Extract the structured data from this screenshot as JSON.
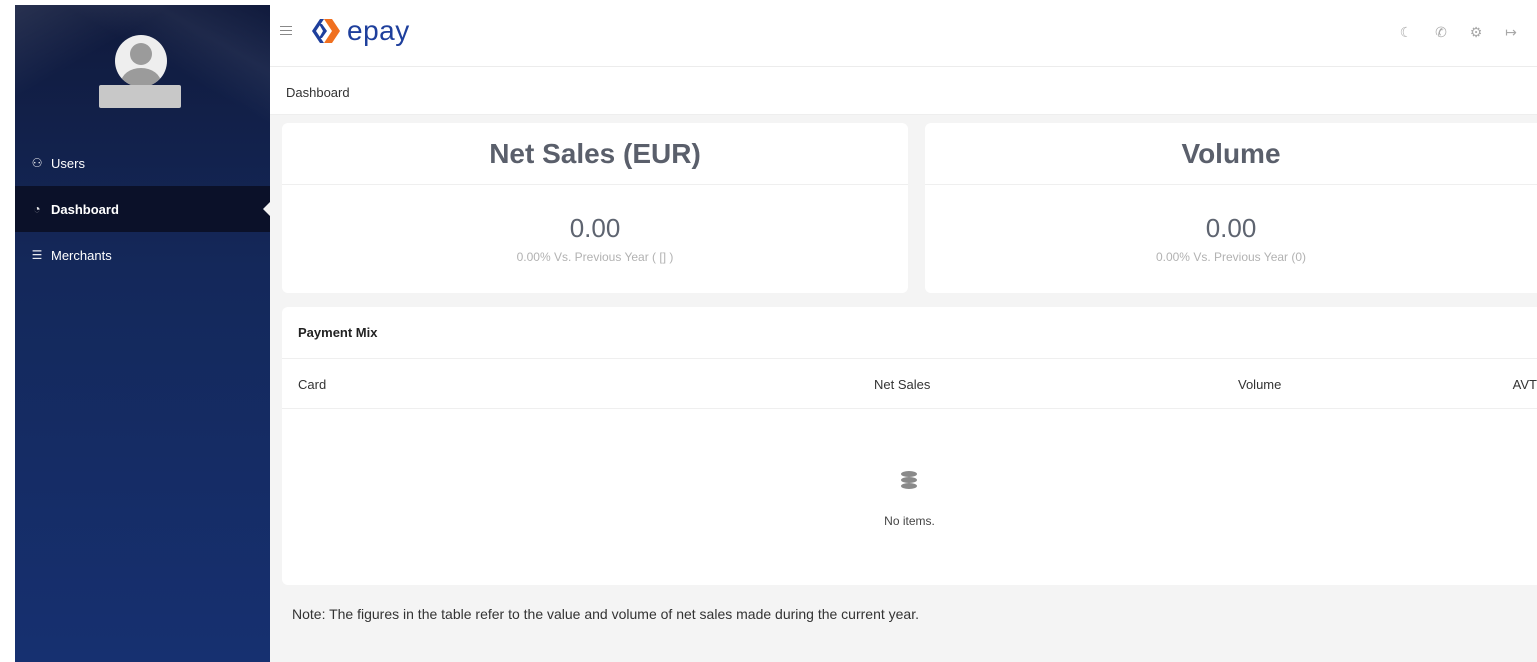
{
  "app": {
    "brand": "epay",
    "brand_color": "#1e3f9c",
    "accent_color": "#f07020",
    "sidebar_color": "#14285a"
  },
  "sidebar": {
    "items": [
      {
        "label": "Users",
        "icon": "users-icon",
        "active": false
      },
      {
        "label": "Dashboard",
        "icon": "dashboard-icon",
        "active": true
      },
      {
        "label": "Merchants",
        "icon": "merchants-icon",
        "active": false
      }
    ]
  },
  "header": {
    "icons": [
      "moon-icon",
      "phone-icon",
      "gear-icon",
      "logout-icon"
    ]
  },
  "breadcrumb": {
    "current": "Dashboard"
  },
  "kpis": {
    "net_sales": {
      "title": "Net Sales (EUR)",
      "value": "0.00",
      "comparison": "0.00% Vs. Previous Year ( [] )"
    },
    "volume": {
      "title": "Volume",
      "value": "0.00",
      "comparison": "0.00% Vs. Previous Year (0)"
    }
  },
  "payment_mix": {
    "title": "Payment Mix",
    "columns": [
      "Card",
      "Net Sales",
      "Volume",
      "AVT"
    ],
    "rows": [],
    "empty_text": "No items."
  },
  "note": "Note: The figures in the table refer to the value and volume of net sales made during the current year."
}
